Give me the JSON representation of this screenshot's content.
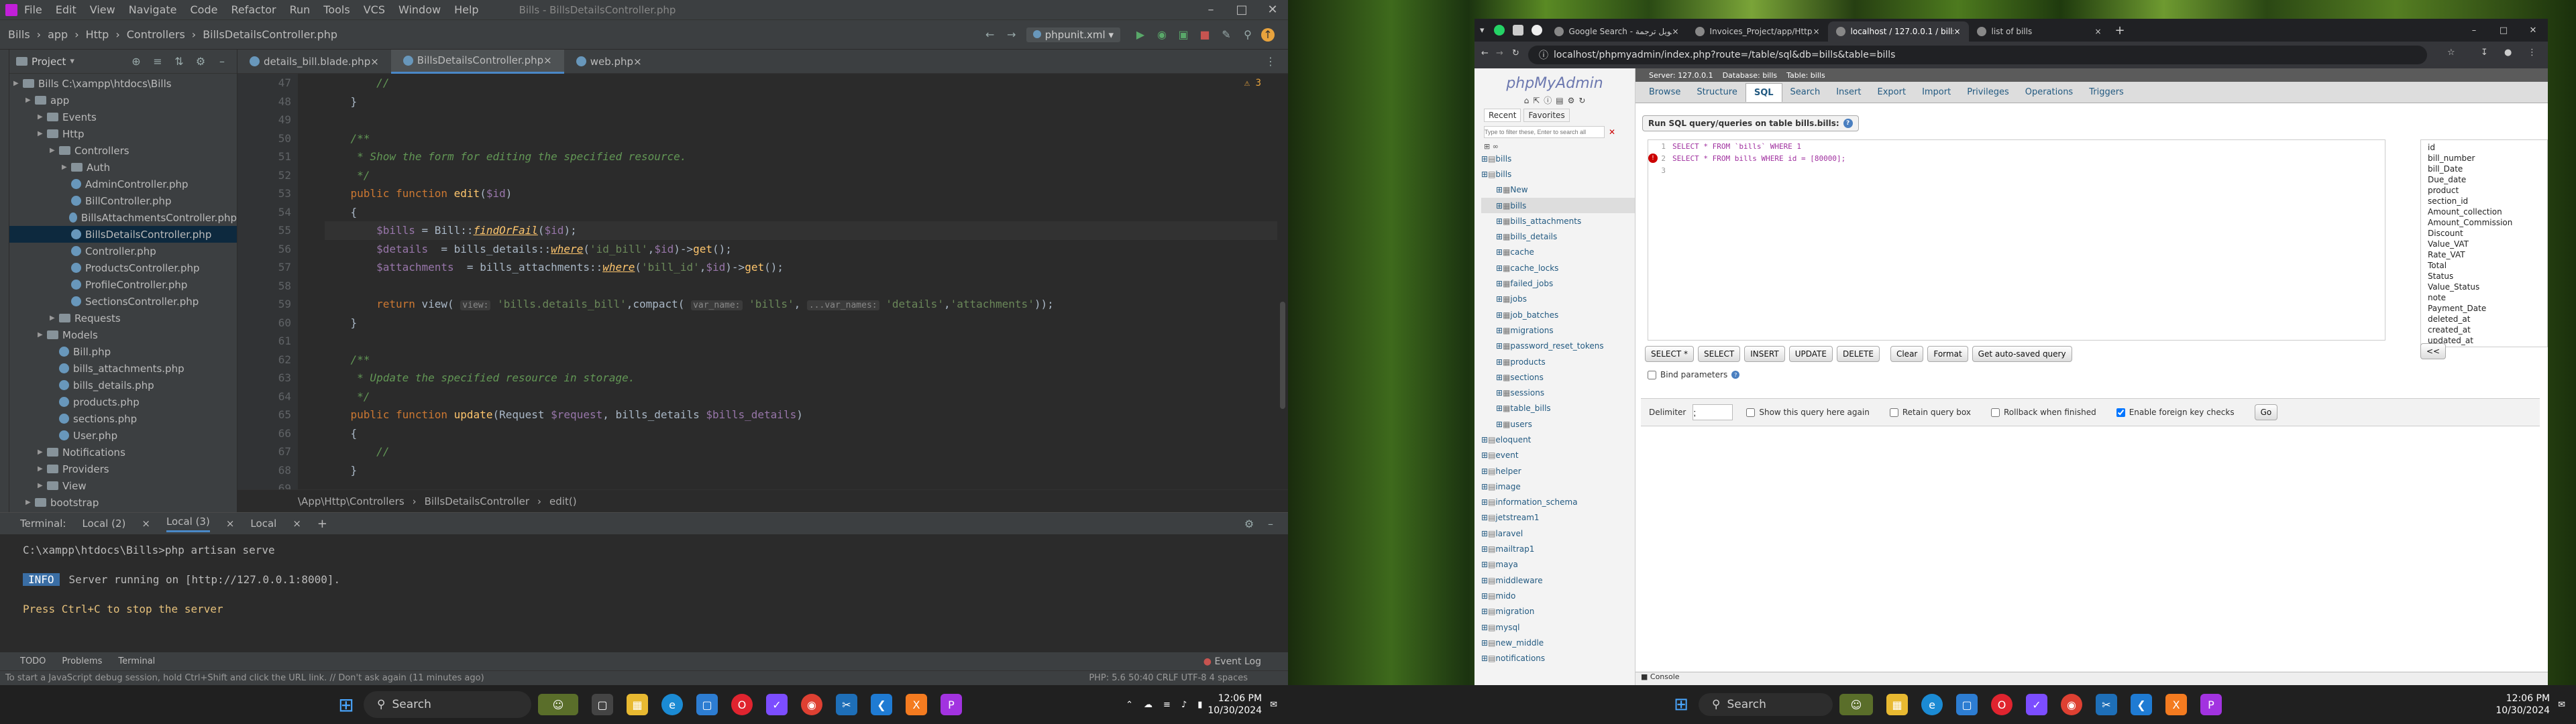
{
  "ide": {
    "title": "Bills - BillsDetailsController.php",
    "menu": [
      "File",
      "Edit",
      "View",
      "Navigate",
      "Code",
      "Refactor",
      "Run",
      "Tools",
      "VCS",
      "Window",
      "Help"
    ],
    "breadcrumbs": [
      "Bills",
      "app",
      "Http",
      "Controllers",
      "BillsDetailsController.php"
    ],
    "run_config": "phpunit.xml",
    "project_label": "Project",
    "tree": [
      {
        "label": "Bills  C:\\xampp\\htdocs\\Bills",
        "depth": 0,
        "kind": "folder"
      },
      {
        "label": "app",
        "depth": 1,
        "kind": "folder"
      },
      {
        "label": "Events",
        "depth": 2,
        "kind": "folder"
      },
      {
        "label": "Http",
        "depth": 2,
        "kind": "folder"
      },
      {
        "label": "Controllers",
        "depth": 3,
        "kind": "folder"
      },
      {
        "label": "Auth",
        "depth": 4,
        "kind": "folder"
      },
      {
        "label": "AdminController.php",
        "depth": 4,
        "kind": "php"
      },
      {
        "label": "BillController.php",
        "depth": 4,
        "kind": "php"
      },
      {
        "label": "BillsAttachmentsController.php",
        "depth": 4,
        "kind": "php"
      },
      {
        "label": "BillsDetailsController.php",
        "depth": 4,
        "kind": "php",
        "selected": true
      },
      {
        "label": "Controller.php",
        "depth": 4,
        "kind": "php"
      },
      {
        "label": "ProductsController.php",
        "depth": 4,
        "kind": "php"
      },
      {
        "label": "ProfileController.php",
        "depth": 4,
        "kind": "php"
      },
      {
        "label": "SectionsController.php",
        "depth": 4,
        "kind": "php"
      },
      {
        "label": "Requests",
        "depth": 3,
        "kind": "folder"
      },
      {
        "label": "Models",
        "depth": 2,
        "kind": "folder"
      },
      {
        "label": "Bill.php",
        "depth": 3,
        "kind": "php"
      },
      {
        "label": "bills_attachments.php",
        "depth": 3,
        "kind": "php"
      },
      {
        "label": "bills_details.php",
        "depth": 3,
        "kind": "php"
      },
      {
        "label": "products.php",
        "depth": 3,
        "kind": "php"
      },
      {
        "label": "sections.php",
        "depth": 3,
        "kind": "php"
      },
      {
        "label": "User.php",
        "depth": 3,
        "kind": "php"
      },
      {
        "label": "Notifications",
        "depth": 2,
        "kind": "folder"
      },
      {
        "label": "Providers",
        "depth": 2,
        "kind": "folder"
      },
      {
        "label": "View",
        "depth": 2,
        "kind": "folder"
      },
      {
        "label": "bootstrap",
        "depth": 1,
        "kind": "folder"
      }
    ],
    "tabs": [
      "details_bill.blade.php",
      "BillsDetailsController.php",
      "web.php"
    ],
    "active_tab": 1,
    "warnings": "3",
    "line_numbers": [
      "47",
      "48",
      "49",
      "50",
      "51",
      "52",
      "53",
      "54",
      "55",
      "56",
      "57",
      "58",
      "59",
      "60",
      "61",
      "62",
      "63",
      "64",
      "65",
      "66",
      "67",
      "68",
      "69"
    ],
    "code_breadcrumb": [
      "\\App\\Http\\Controllers",
      "BillsDetailsController",
      "edit()"
    ],
    "terminal": {
      "label": "Terminal:",
      "tabs": [
        "Local (2)",
        "Local (3)",
        "Local"
      ],
      "lines": [
        "C:\\xampp\\htdocs\\Bills>php artisan serve",
        "Server running on [http://127.0.0.1:8000].",
        "Press Ctrl+C to stop the server"
      ],
      "info_badge": "INFO"
    },
    "bottom_tools": [
      "TODO",
      "Problems",
      "Terminal"
    ],
    "event_log": "Event Log",
    "status": "To start a JavaScript debug session, hold Ctrl+Shift and click the URL link. // Don't ask again (11 minutes ago)",
    "status_right": "PHP: 5.6   50:40   CRLF   UTF-8   4 spaces"
  },
  "taskbar_left": {
    "search": "Search",
    "time": "12:06 PM",
    "date": "10/30/2024"
  },
  "taskbar_right": {
    "search": "Search",
    "time": "12:06 PM",
    "date": "10/30/2024"
  },
  "browser": {
    "tabs": [
      "Google Search - تحويل ترجمة",
      "Invoices_Project/app/Http/Co",
      "localhost / 127.0.0.1 / bills / bi",
      "list of bills"
    ],
    "active_tab": 2,
    "url": "localhost/phpmyadmin/index.php?route=/table/sql&db=bills&table=bills"
  },
  "pma": {
    "logo": "phpMyAdmin",
    "recent": "Recent",
    "favorites": "Favorites",
    "filter_placeholder": "Type to filter these, Enter to search all",
    "breadcrumb": [
      "Server: 127.0.0.1",
      "Database: bills",
      "Table: bills"
    ],
    "tabs": [
      "Browse",
      "Structure",
      "SQL",
      "Search",
      "Insert",
      "Export",
      "Import",
      "Privileges",
      "Operations",
      "Triggers"
    ],
    "active_tab": 2,
    "run_sql_label": "Run SQL query/queries on table bills.bills:",
    "sql_lines": [
      "SELECT * FROM `bills` WHERE 1",
      "SELECT * FROM bills WHERE id = [80000];"
    ],
    "columns": [
      "id",
      "bill_number",
      "bill_Date",
      "Due_date",
      "product",
      "section_id",
      "Amount_collection",
      "Amount_Commission",
      "Discount",
      "Value_VAT",
      "Rate_VAT",
      "Total",
      "Status",
      "Value_Status",
      "note",
      "Payment_Date",
      "deleted_at",
      "created_at",
      "updated_at"
    ],
    "sql_buttons": [
      "SELECT *",
      "SELECT",
      "INSERT",
      "UPDATE",
      "DELETE",
      "Clear",
      "Format",
      "Get auto-saved query"
    ],
    "insert_col_btn": "<<",
    "bind_params": "Bind parameters",
    "delimiter_label": "Delimiter",
    "delimiter_value": ";",
    "options": [
      "Show this query here again",
      "Retain query box",
      "Rollback when finished",
      "Enable foreign key checks"
    ],
    "go": "Go",
    "console": "Console",
    "db_tree": [
      {
        "label": "bills",
        "depth": 0
      },
      {
        "label": "bills",
        "depth": 0
      },
      {
        "label": "New",
        "depth": 1
      },
      {
        "label": "bills",
        "depth": 1,
        "selected": true
      },
      {
        "label": "bills_attachments",
        "depth": 1
      },
      {
        "label": "bills_details",
        "depth": 1
      },
      {
        "label": "cache",
        "depth": 1
      },
      {
        "label": "cache_locks",
        "depth": 1
      },
      {
        "label": "failed_jobs",
        "depth": 1
      },
      {
        "label": "jobs",
        "depth": 1
      },
      {
        "label": "job_batches",
        "depth": 1
      },
      {
        "label": "migrations",
        "depth": 1
      },
      {
        "label": "password_reset_tokens",
        "depth": 1
      },
      {
        "label": "products",
        "depth": 1
      },
      {
        "label": "sections",
        "depth": 1
      },
      {
        "label": "sessions",
        "depth": 1
      },
      {
        "label": "table_bills",
        "depth": 1
      },
      {
        "label": "users",
        "depth": 1
      },
      {
        "label": "eloquent",
        "depth": 0
      },
      {
        "label": "event",
        "depth": 0
      },
      {
        "label": "helper",
        "depth": 0
      },
      {
        "label": "image",
        "depth": 0
      },
      {
        "label": "information_schema",
        "depth": 0
      },
      {
        "label": "jetstream1",
        "depth": 0
      },
      {
        "label": "laravel",
        "depth": 0
      },
      {
        "label": "mailtrap1",
        "depth": 0
      },
      {
        "label": "maya",
        "depth": 0
      },
      {
        "label": "middleware",
        "depth": 0
      },
      {
        "label": "mido",
        "depth": 0
      },
      {
        "label": "migration",
        "depth": 0
      },
      {
        "label": "mysql",
        "depth": 0
      },
      {
        "label": "new_middle",
        "depth": 0
      },
      {
        "label": "notifications",
        "depth": 0
      }
    ]
  }
}
